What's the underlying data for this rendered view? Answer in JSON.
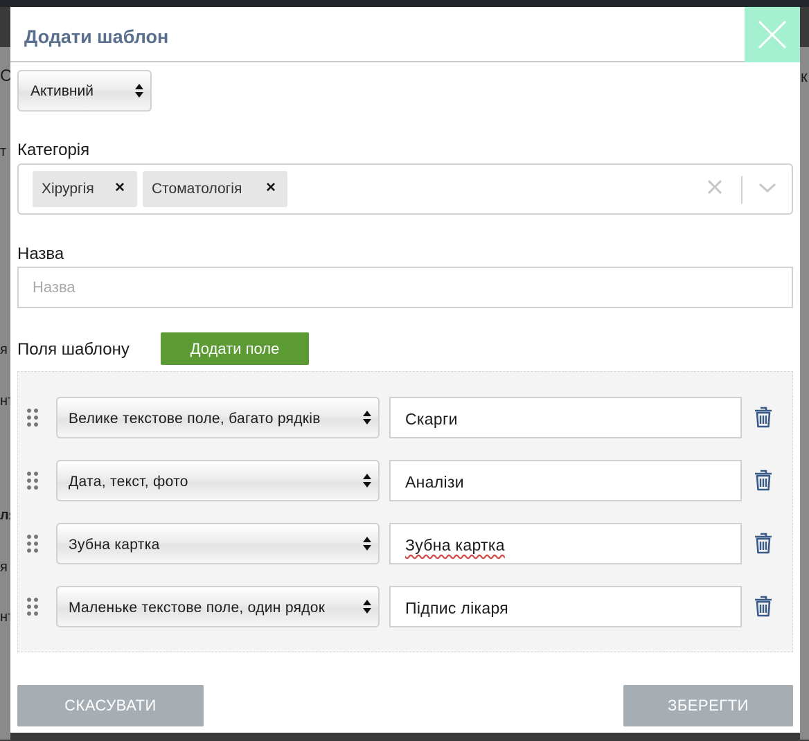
{
  "modal": {
    "title": "Додати шаблон"
  },
  "background_fragments": [
    "С",
    "к",
    "т",
    "я",
    "нт",
    "ля",
    "я",
    "нт"
  ],
  "status": {
    "value": "Активний"
  },
  "category": {
    "label": "Категорія",
    "chips": [
      "Хірургія",
      "Стоматологія"
    ]
  },
  "name": {
    "label": "Назва",
    "placeholder": "Назва",
    "value": ""
  },
  "template_fields": {
    "label": "Поля шаблону",
    "add_button": "Додати поле",
    "rows": [
      {
        "type": "Велике текстове поле, багато рядків",
        "name": "Скарги"
      },
      {
        "type": "Дата, текст, фото",
        "name": "Аналізи"
      },
      {
        "type": "Зубна картка",
        "name": "Зубна картка"
      },
      {
        "type": "Маленьке текстове поле, один рядок",
        "name": "Підпис лікаря"
      }
    ]
  },
  "footer": {
    "cancel": "СКАСУВАТИ",
    "save": "ЗБЕРЕГТИ"
  },
  "colors": {
    "title": "#5a6f8e",
    "close_bg": "#a6f0d2",
    "add_button": "#5c9a34",
    "footer_buttons": "#a6aeb4"
  }
}
